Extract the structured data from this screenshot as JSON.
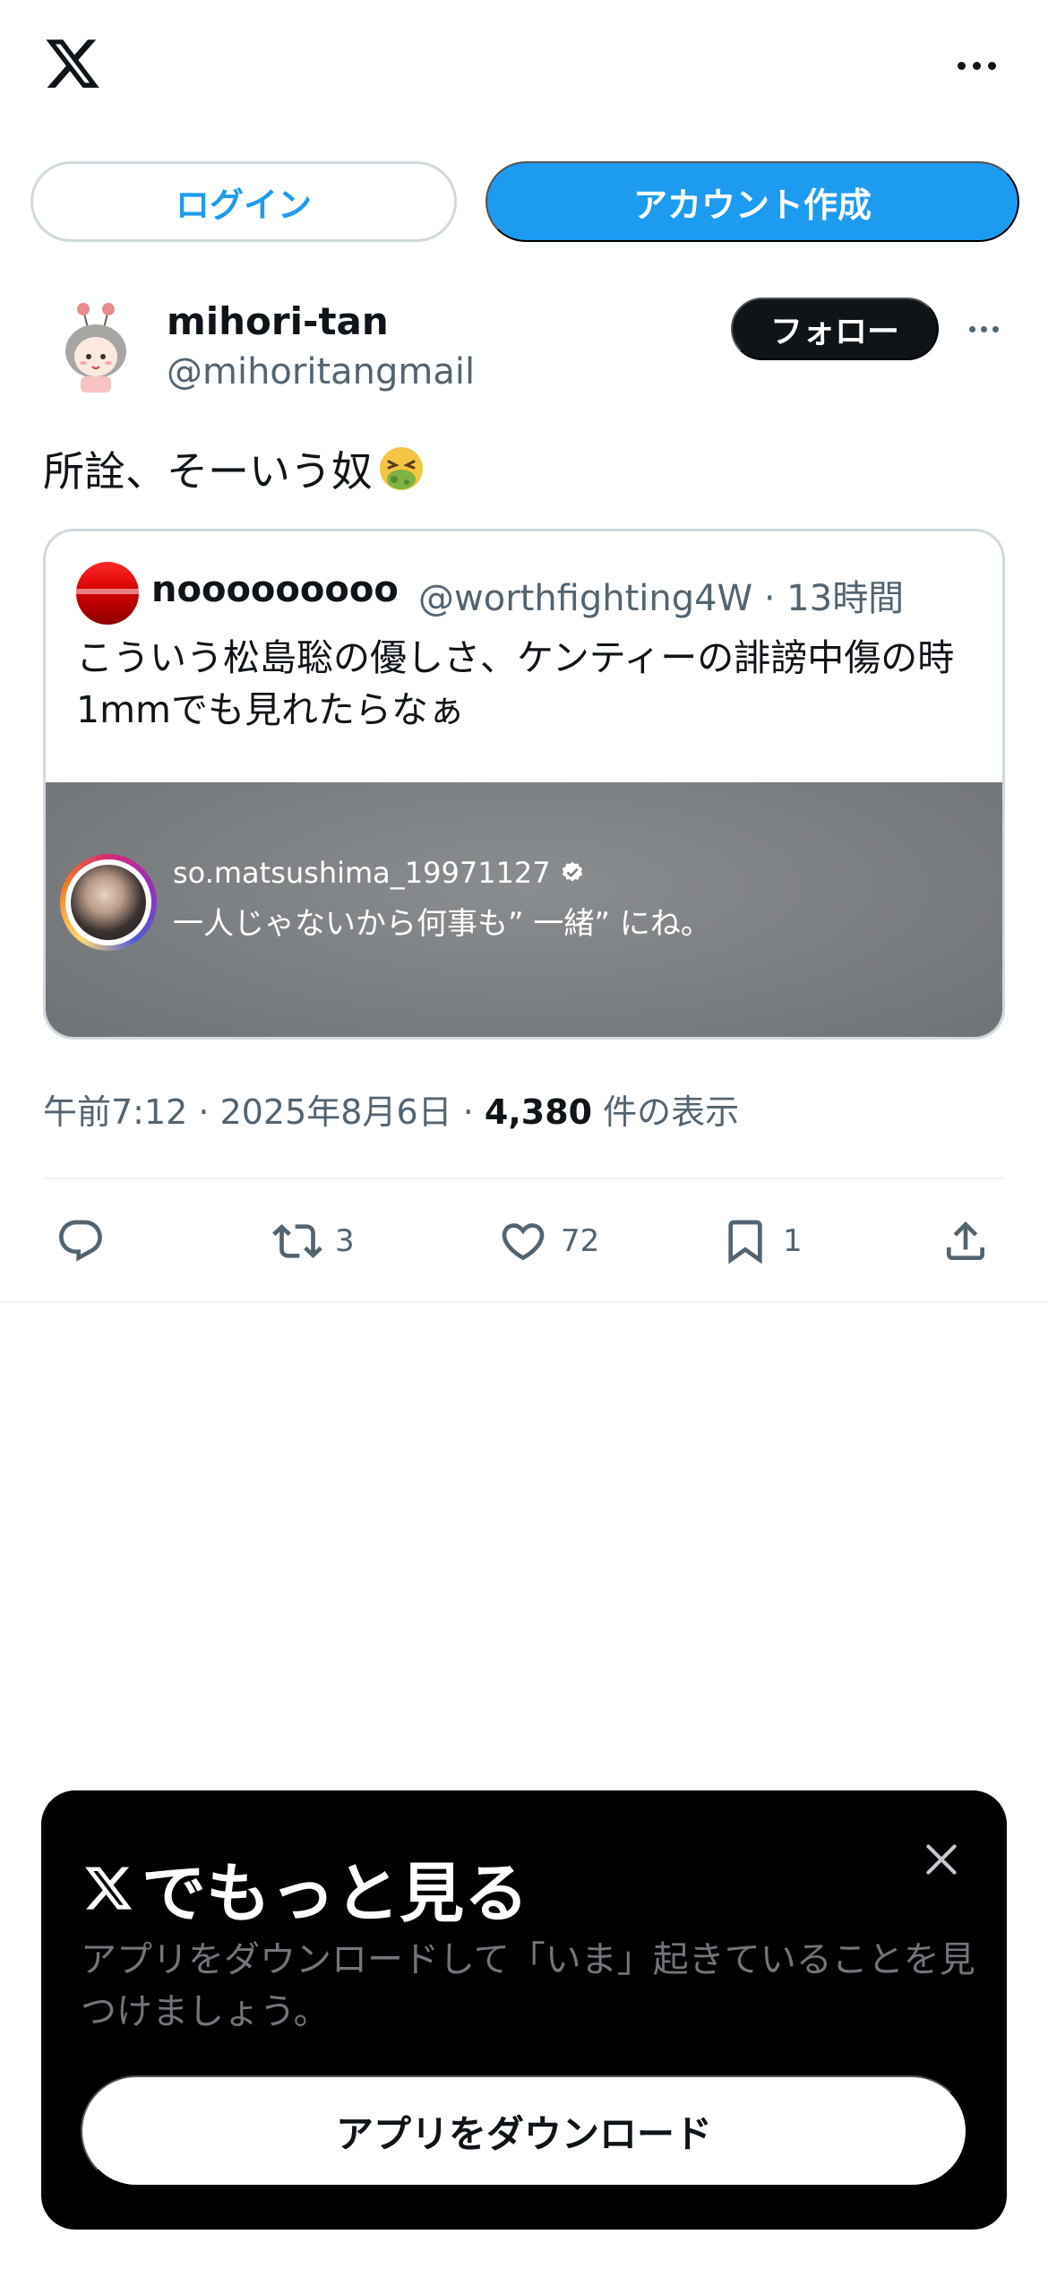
{
  "header": {
    "login_label": "ログイン",
    "signup_label": "アカウント作成"
  },
  "tweet": {
    "author_name": "mihori-tan",
    "author_handle": "@mihoritangmail",
    "follow_label": "フォロー",
    "text": "所詮、そーいう奴",
    "emoji": "nauseated-face-emoji",
    "quote": {
      "name": "nooooooooo",
      "handle_time": "@worthfighting4W · 13時間",
      "text": "こういう松島聡の優しさ、ケンティーの誹謗中傷の時1mmでも見れたらなぁ",
      "media": {
        "username": "so.matsushima_19971127",
        "caption": "一人じゃないから何事も” 一緒” にね。"
      }
    },
    "meta": {
      "time_date": "午前7:12 · 2025年8月6日 · ",
      "views": "4,380",
      "views_suffix": " 件の表示"
    },
    "actions": {
      "reply_count": "",
      "retweet_count": "3",
      "like_count": "72",
      "bookmark_count": "1"
    }
  },
  "sheet": {
    "title": "でもっと見る",
    "body": "アプリをダウンロードして「いま」起きていることを見つけましょう。",
    "download_label": "アプリをダウンロード"
  },
  "colors": {
    "accent": "#1d9bf0",
    "text": "#0f1419",
    "secondary": "#536471",
    "sheet_bg": "#000000"
  }
}
